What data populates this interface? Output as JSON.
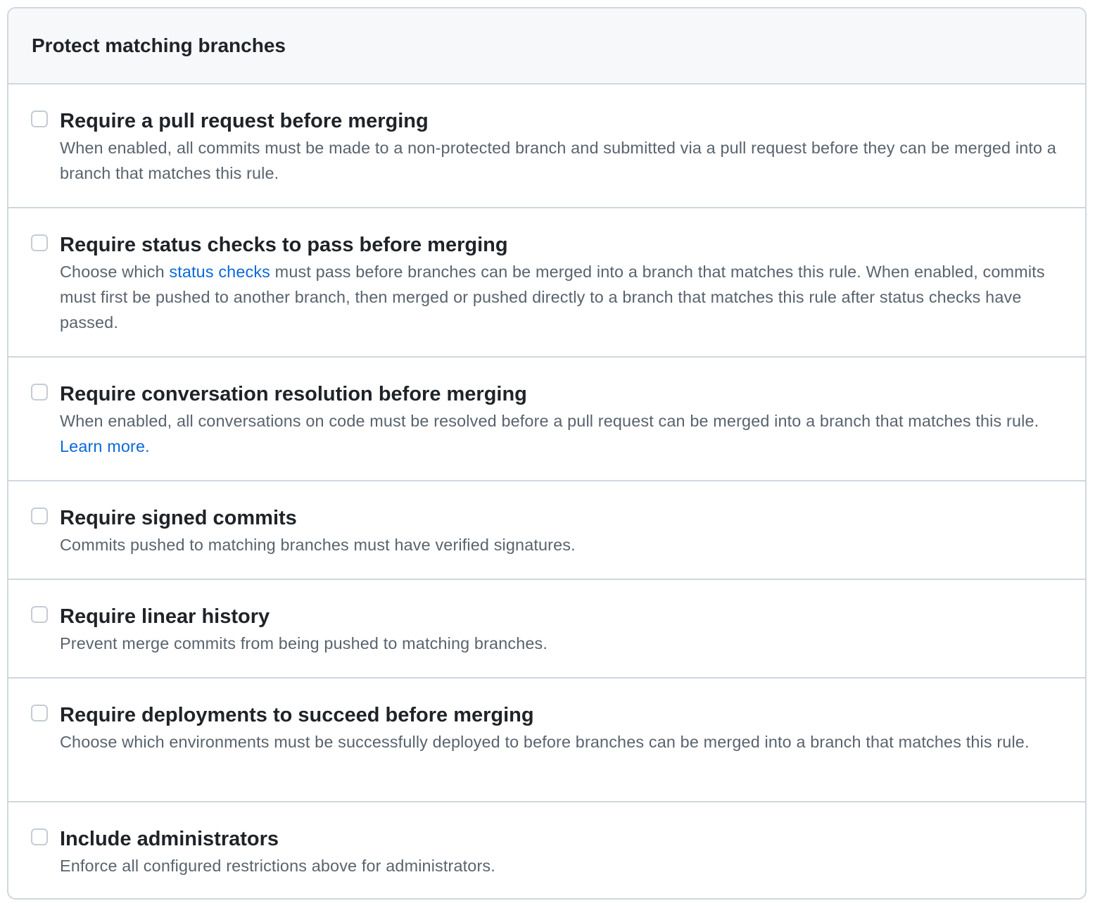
{
  "panel": {
    "title": "Protect matching branches"
  },
  "rules": [
    {
      "title": "Require a pull request before merging",
      "checked": false,
      "description": "When enabled, all commits must be made to a non-protected branch and submitted via a pull request before they can be merged into a branch that matches this rule."
    },
    {
      "title": "Require status checks to pass before merging",
      "checked": false,
      "description_before": "Choose which ",
      "link": "status checks",
      "description_after": " must pass before branches can be merged into a branch that matches this rule. When enabled, commits must first be pushed to another branch, then merged or pushed directly to a branch that matches this rule after status checks have passed."
    },
    {
      "title": "Require conversation resolution before merging",
      "checked": false,
      "description_before": "When enabled, all conversations on code must be resolved before a pull request can be merged into a branch that matches this rule. ",
      "link": "Learn more."
    },
    {
      "title": "Require signed commits",
      "checked": false,
      "description": "Commits pushed to matching branches must have verified signatures."
    },
    {
      "title": "Require linear history",
      "checked": false,
      "description": "Prevent merge commits from being pushed to matching branches."
    },
    {
      "title": "Require deployments to succeed before merging",
      "checked": false,
      "description": "Choose which environments must be successfully deployed to before branches can be merged into a branch that matches this rule."
    },
    {
      "title": "Include administrators",
      "checked": false,
      "description": "Enforce all configured restrictions above for administrators."
    }
  ],
  "colors": {
    "link": "#0969da",
    "border": "#d0d7de",
    "header_bg": "#f6f8fa",
    "muted_text": "#59636e"
  }
}
